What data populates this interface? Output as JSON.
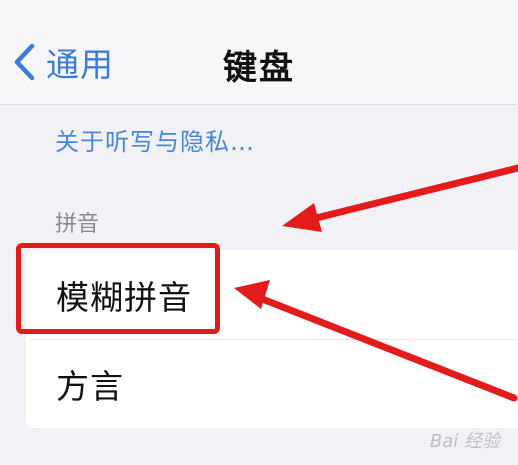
{
  "navbar": {
    "back_label": "通用",
    "back_icon": "chevron-left-icon",
    "title": "键盘"
  },
  "about_link": "关于听写与隐私…",
  "section": {
    "header": "拼音",
    "items": [
      {
        "label": "模糊拼音"
      },
      {
        "label": "方言"
      }
    ]
  },
  "annotation": {
    "highlight_color": "#e31b1b"
  },
  "watermark": "Bai 经验"
}
